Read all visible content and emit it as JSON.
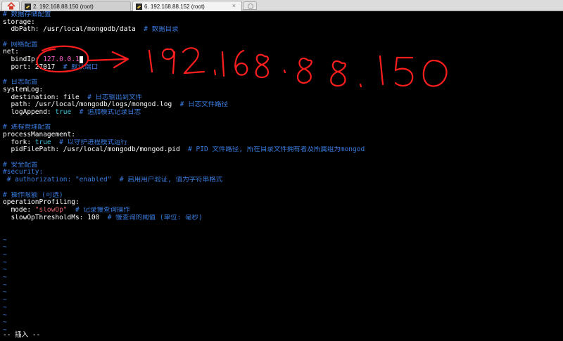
{
  "tabs": [
    {
      "label": "2. 192.168.88.150 (root)",
      "active": false
    },
    {
      "label": "6. 192.168.88.152 (root)",
      "active": true,
      "close": "×"
    }
  ],
  "editor": {
    "lines": [
      [
        {
          "t": "# 数据存储配置",
          "c": "comment"
        }
      ],
      [
        {
          "t": "storage:",
          "c": "text"
        }
      ],
      [
        {
          "t": "  dbPath: /usr/local/mongodb/data  ",
          "c": "text"
        },
        {
          "t": "# 数据目录",
          "c": "comment"
        }
      ],
      [],
      [
        {
          "t": "# 网络配置",
          "c": "comment"
        }
      ],
      [
        {
          "t": "net:",
          "c": "text"
        }
      ],
      [
        {
          "t": "  bindIp: ",
          "c": "text"
        },
        {
          "t": "127.0.0.1",
          "c": "ip"
        },
        {
          "t": "",
          "c": "cursor"
        }
      ],
      [
        {
          "t": "  port: 27017  ",
          "c": "text"
        },
        {
          "t": "# 默认端口",
          "c": "comment"
        }
      ],
      [],
      [
        {
          "t": "# 日志配置",
          "c": "comment"
        }
      ],
      [
        {
          "t": "systemLog:",
          "c": "text"
        }
      ],
      [
        {
          "t": "  destination: file  ",
          "c": "text"
        },
        {
          "t": "# 日志输出到文件",
          "c": "comment"
        }
      ],
      [
        {
          "t": "  path: /usr/local/mongodb/logs/mongod.log  ",
          "c": "text"
        },
        {
          "t": "# 日志文件路径",
          "c": "comment"
        }
      ],
      [
        {
          "t": "  logAppend: ",
          "c": "text"
        },
        {
          "t": "true",
          "c": "true"
        },
        {
          "t": "  ",
          "c": "text"
        },
        {
          "t": "# 追加模式记录日志",
          "c": "comment"
        }
      ],
      [],
      [
        {
          "t": "# 进程管理配置",
          "c": "comment"
        }
      ],
      [
        {
          "t": "processManagement:",
          "c": "text"
        }
      ],
      [
        {
          "t": "  fork: ",
          "c": "text"
        },
        {
          "t": "true",
          "c": "true"
        },
        {
          "t": "  ",
          "c": "text"
        },
        {
          "t": "# 以守护进程模式运行",
          "c": "comment"
        }
      ],
      [
        {
          "t": "  pidFilePath: /usr/local/mongodb/mongod.pid  ",
          "c": "text"
        },
        {
          "t": "# PID 文件路径, 所在目录文件拥有者及所属组为mongod",
          "c": "comment"
        }
      ],
      [],
      [
        {
          "t": "# 安全配置",
          "c": "comment"
        }
      ],
      [
        {
          "t": "#security:",
          "c": "comment"
        }
      ],
      [
        {
          "t": " # authorization: \"enabled\"  # 启用用户验证, 值为字符串格式",
          "c": "comment"
        }
      ],
      [],
      [
        {
          "t": "# 操作限额 (可选)",
          "c": "comment"
        }
      ],
      [
        {
          "t": "operationProfiling:",
          "c": "text"
        }
      ],
      [
        {
          "t": "  mode: ",
          "c": "text"
        },
        {
          "t": "\"slowOp\"",
          "c": "str"
        },
        {
          "t": "  ",
          "c": "text"
        },
        {
          "t": "# 记录慢查询操作",
          "c": "comment"
        }
      ],
      [
        {
          "t": "  slowOpThresholdMs: 100  ",
          "c": "text"
        },
        {
          "t": "# 慢查询的阈值 (单位: 毫秒)",
          "c": "comment"
        }
      ],
      [],
      [],
      [
        {
          "t": "~",
          "c": "tilde"
        }
      ],
      [
        {
          "t": "~",
          "c": "tilde"
        }
      ],
      [
        {
          "t": "~",
          "c": "tilde"
        }
      ],
      [
        {
          "t": "~",
          "c": "tilde"
        }
      ],
      [
        {
          "t": "~",
          "c": "tilde"
        }
      ],
      [
        {
          "t": "~",
          "c": "tilde"
        }
      ],
      [
        {
          "t": "~",
          "c": "tilde"
        }
      ],
      [
        {
          "t": "~",
          "c": "tilde"
        }
      ],
      [
        {
          "t": "~",
          "c": "tilde"
        }
      ],
      [
        {
          "t": "~",
          "c": "tilde"
        }
      ],
      [
        {
          "t": "~",
          "c": "tilde"
        }
      ],
      [
        {
          "t": "~",
          "c": "tilde"
        }
      ],
      [
        {
          "t": "~",
          "c": "tilde"
        }
      ]
    ],
    "status": "-- 插入 --"
  },
  "annotation": {
    "handwritten_text": "192.168.88.150",
    "color": "#ff1e1e"
  },
  "colors": {
    "comment": "#3a7de0",
    "true": "#3fc4d8",
    "ip": "#ff64d0",
    "string": "#e0636b",
    "tilde": "#3a7de0",
    "text": "#ffffff",
    "background": "#000000"
  }
}
